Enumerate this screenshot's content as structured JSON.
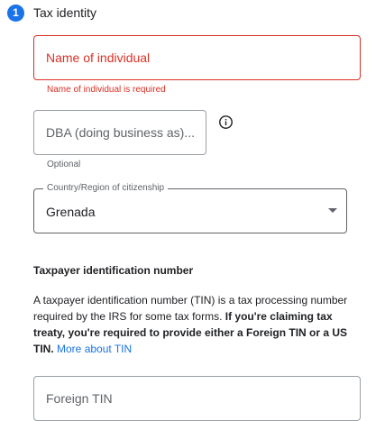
{
  "step": {
    "number": "1",
    "title": "Tax identity"
  },
  "name_field": {
    "placeholder": "Name of individual",
    "error": "Name of individual is required"
  },
  "dba_field": {
    "placeholder": "DBA (doing business as)...",
    "helper": "Optional",
    "info_icon": "info-icon"
  },
  "citizenship": {
    "label": "Country/Region of citizenship",
    "value": "Grenada"
  },
  "tin_section": {
    "title": "Taxpayer identification number",
    "text_plain": "A taxpayer identification number (TIN) is a tax processing number required by the IRS for some tax forms. ",
    "text_bold": "If you're claiming tax treaty, you're required to provide either a Foreign TIN or a US TIN.",
    "link": "More about TIN"
  },
  "foreign_tin_field": {
    "placeholder": "Foreign TIN"
  },
  "colors": {
    "accent": "#1a73e8",
    "error": "#d93025"
  }
}
